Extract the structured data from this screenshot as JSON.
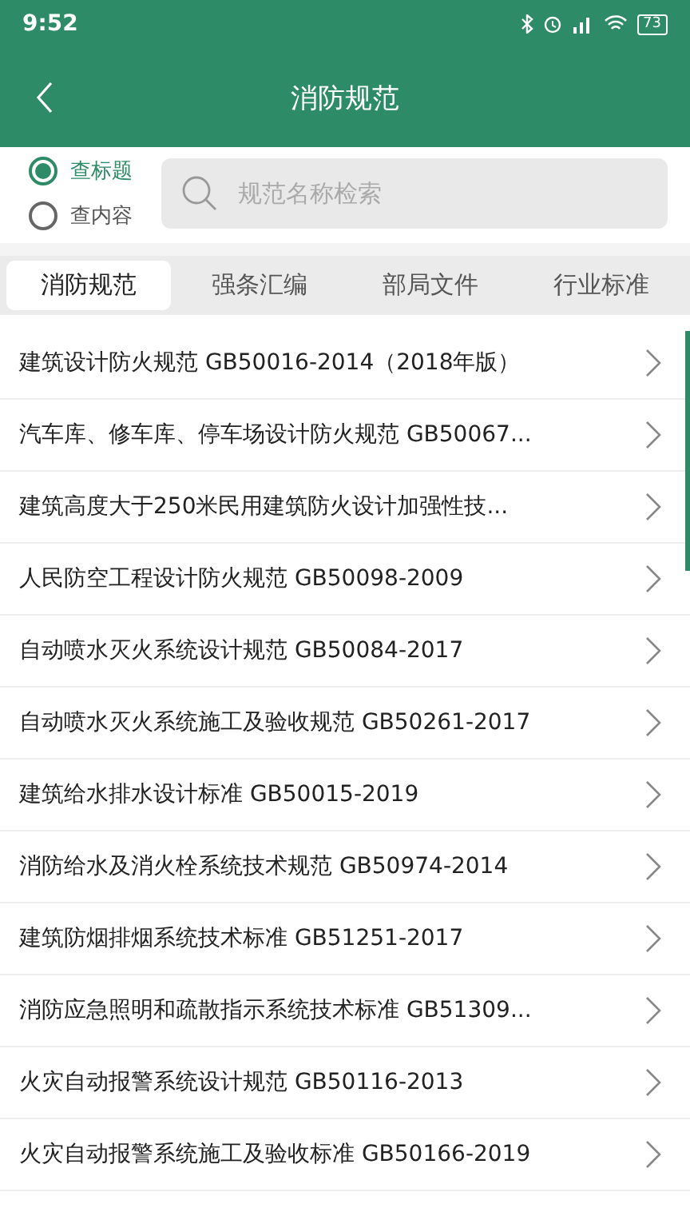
{
  "status_bar": {
    "time": "9:52",
    "battery": "73"
  },
  "header": {
    "title": "消防规范"
  },
  "search_mode": [
    {
      "label": "查标题",
      "selected": true
    },
    {
      "label": "查内容",
      "selected": false
    }
  ],
  "search": {
    "placeholder": "规范名称检索"
  },
  "tabs": [
    {
      "label": "消防规范",
      "selected": true
    },
    {
      "label": "强条汇编",
      "selected": false
    },
    {
      "label": "部局文件",
      "selected": false
    },
    {
      "label": "行业标准",
      "selected": false
    }
  ],
  "items": [
    {
      "title": "建筑设计防火规范 GB50016-2014（2018年版）"
    },
    {
      "title": "汽车库、修车库、停车场设计防火规范 GB50067..."
    },
    {
      "title": "建筑高度大于250米民用建筑防火设计加强性技..."
    },
    {
      "title": "人民防空工程设计防火规范 GB50098-2009"
    },
    {
      "title": "自动喷水灭火系统设计规范 GB50084-2017"
    },
    {
      "title": "自动喷水灭火系统施工及验收规范 GB50261-2017"
    },
    {
      "title": "建筑给水排水设计标准 GB50015-2019"
    },
    {
      "title": "消防给水及消火栓系统技术规范 GB50974-2014"
    },
    {
      "title": "建筑防烟排烟系统技术标准 GB51251-2017"
    },
    {
      "title": "消防应急照明和疏散指示系统技术标准 GB51309..."
    },
    {
      "title": "火灾自动报警系统设计规范 GB50116-2013"
    },
    {
      "title": "火灾自动报警系统施工及验收标准 GB50166-2019"
    }
  ]
}
